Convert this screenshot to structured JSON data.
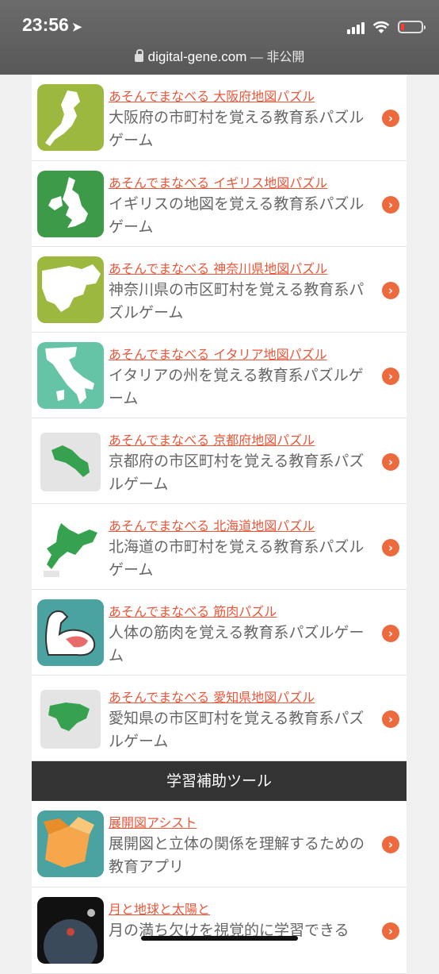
{
  "status": {
    "time": "23:56",
    "location_icon": "location-arrow-icon",
    "battery_color": "#ff3b30"
  },
  "browser": {
    "domain": "digital-gene.com",
    "suffix": " — 非公開"
  },
  "items": [
    {
      "title": "あそんでまなべる 大阪府地図パズル",
      "desc": "大阪府の市町村を覚える教育系パズルゲーム",
      "thumb_bg": "#9cb83e",
      "icon": "osaka-map-icon"
    },
    {
      "title": "あそんでまなべる イギリス地図パズル",
      "desc": "イギリスの地図を覚える教育系パズルゲーム",
      "thumb_bg": "#3c9a49",
      "icon": "uk-map-icon"
    },
    {
      "title": "あそんでまなべる 神奈川県地図パズル",
      "desc": "神奈川県の市区町村を覚える教育系パズルゲーム",
      "thumb_bg": "#9cb83e",
      "icon": "kanagawa-map-icon"
    },
    {
      "title": "あそんでまなべる イタリア地図パズル",
      "desc": "イタリアの州を覚える教育系パズルゲーム",
      "thumb_bg": "#66c4a6",
      "icon": "italy-map-icon"
    },
    {
      "title": "あそんでまなべる 京都府地図パズル",
      "desc": "京都府の市区町村を覚える教育系パズルゲーム",
      "thumb_bg": "#ffffff",
      "icon": "kyoto-map-icon"
    },
    {
      "title": "あそんでまなべる 北海道地図パズル",
      "desc": "北海道の市町村を覚える教育系パズルゲーム",
      "thumb_bg": "#ffffff",
      "icon": "hokkaido-map-icon"
    },
    {
      "title": "あそんでまなべる 筋肉パズル",
      "desc": "人体の筋肉を覚える教育系パズルゲーム",
      "thumb_bg": "#4aa3a0",
      "icon": "muscle-arm-icon"
    },
    {
      "title": "あそんでまなべる 愛知県地図パズル",
      "desc": "愛知県の市区町村を覚える教育系パズルゲーム",
      "thumb_bg": "#ffffff",
      "icon": "aichi-map-icon"
    }
  ],
  "section": {
    "title": "学習補助ツール"
  },
  "tools": [
    {
      "title": "展開図アシスト",
      "desc": "展開図と立体の関係を理解するための教育アプリ",
      "thumb_bg": "#4aa3a0",
      "icon": "folding-box-icon"
    },
    {
      "title": "月と地球と太陽と",
      "desc": "月の満ち欠けを視覚的に学習できる",
      "thumb_bg": "#111111",
      "icon": "moon-earth-icon"
    }
  ],
  "accent": "#e8573a"
}
